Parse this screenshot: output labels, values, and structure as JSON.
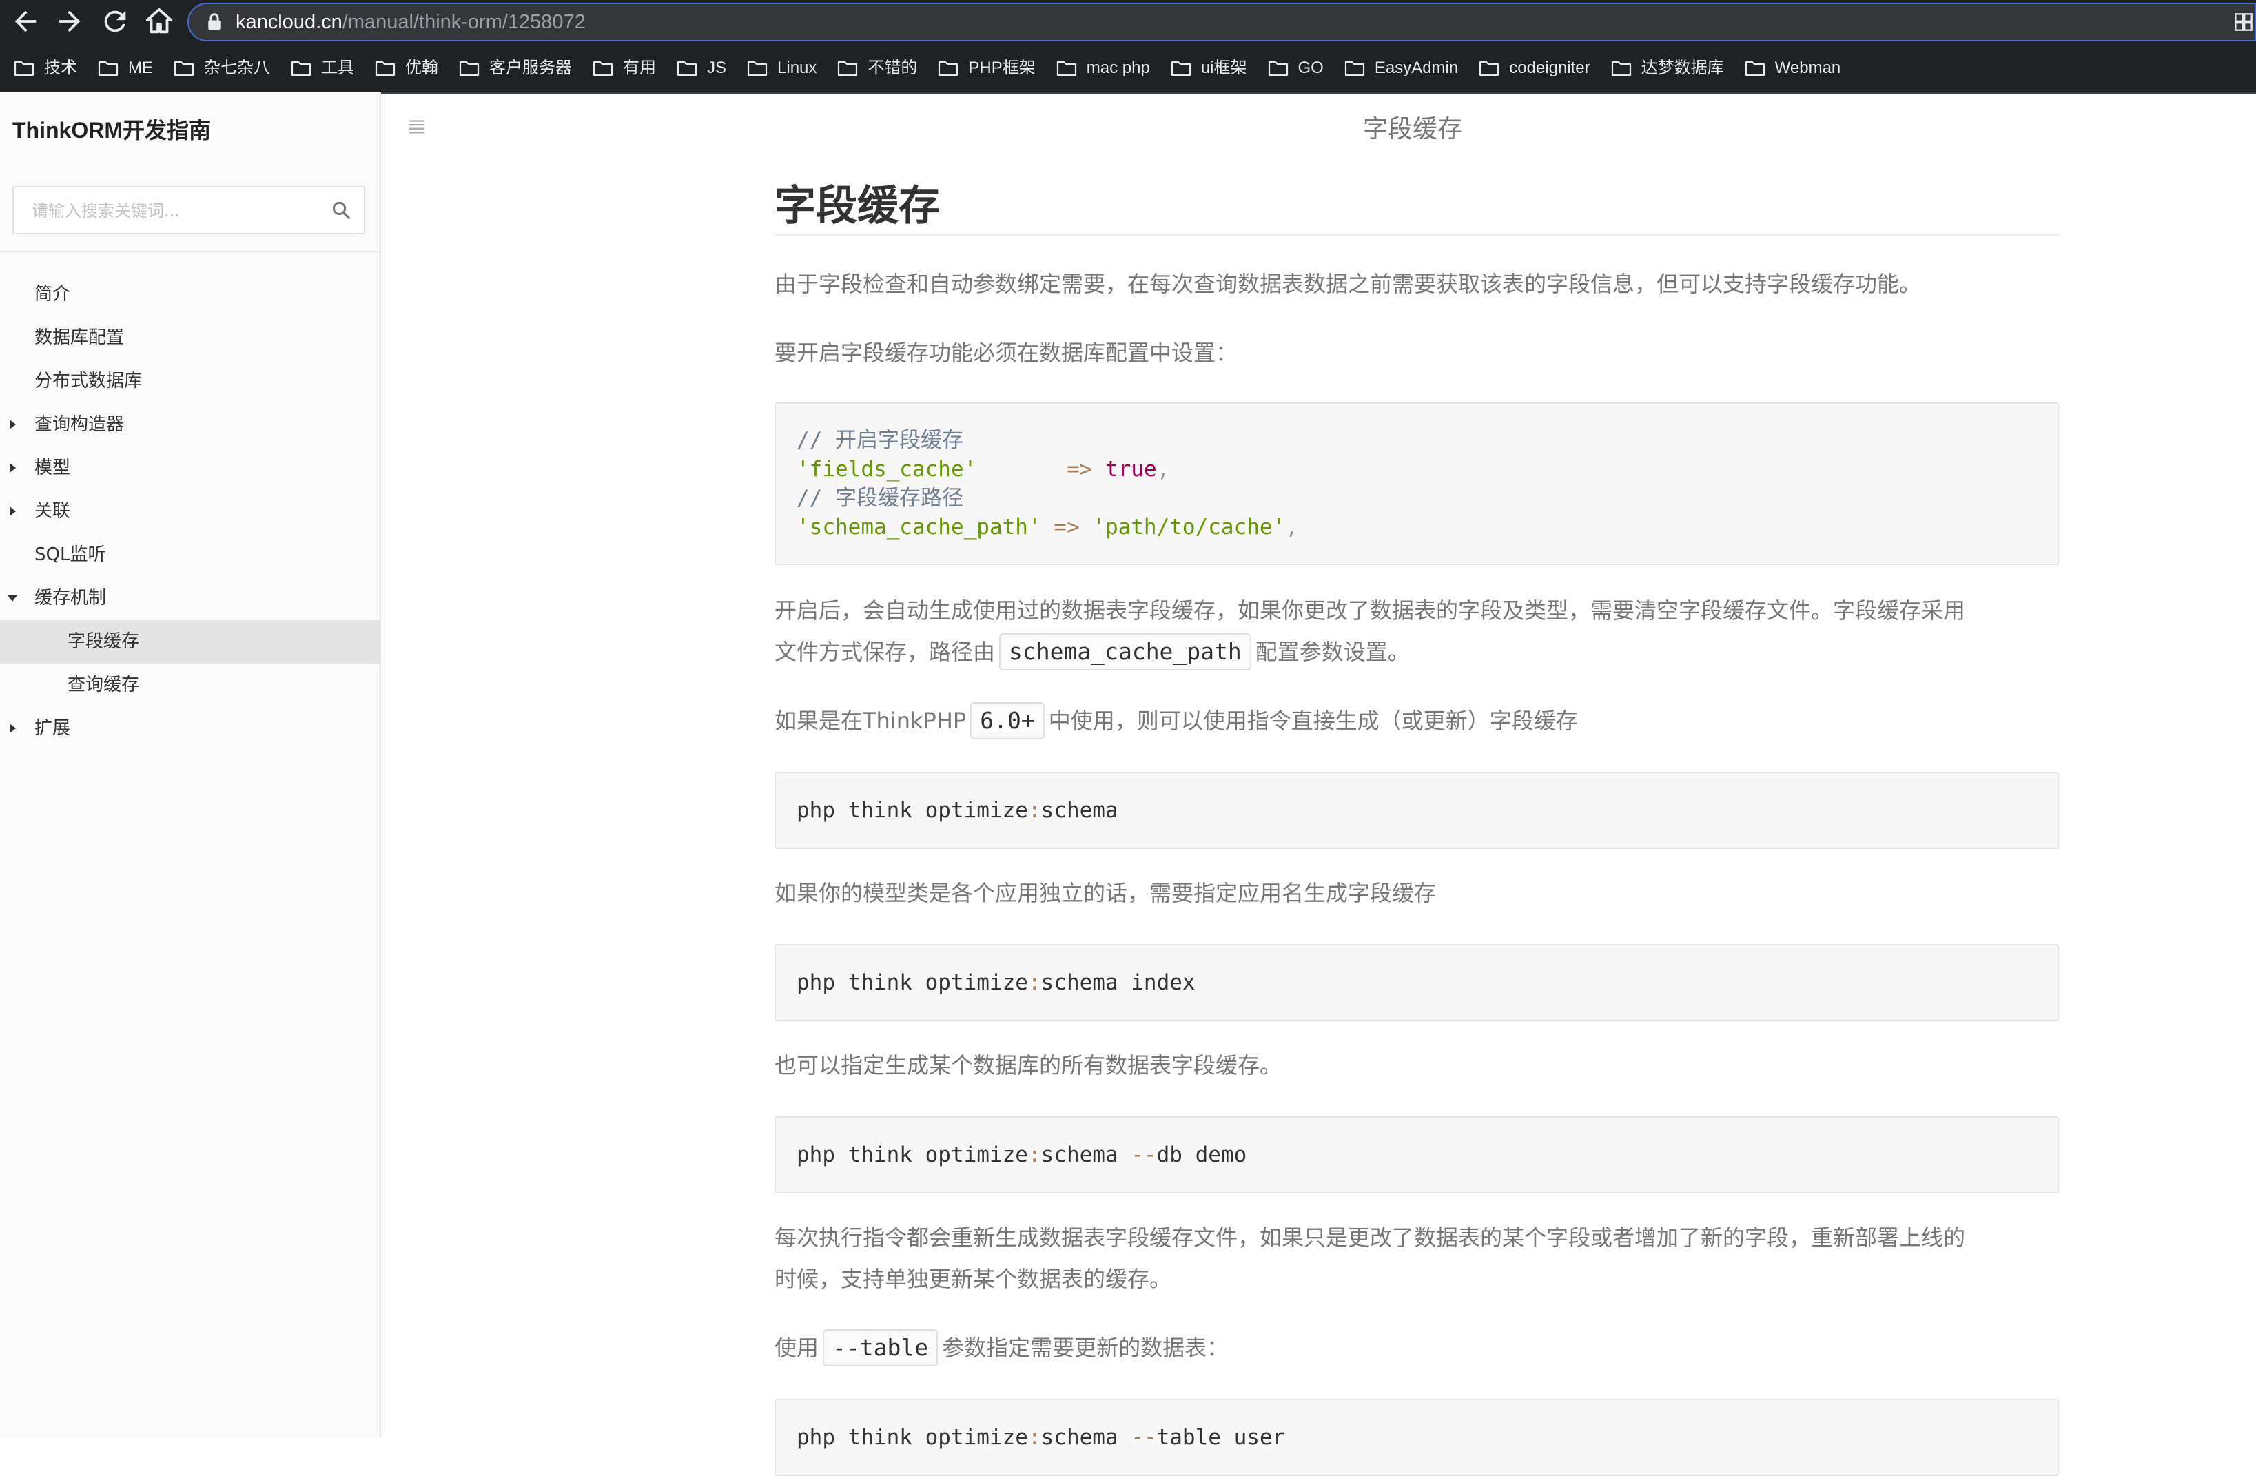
{
  "browser": {
    "url_host": "kancloud.cn",
    "url_path": "/manual/think-orm/1258072",
    "bookmarks": [
      "技术",
      "ME",
      "杂七杂八",
      "工具",
      "优翰",
      "客户服务器",
      "有用",
      "JS",
      "Linux",
      "不错的",
      "PHP框架",
      "mac php",
      "ui框架",
      "GO",
      "EasyAdmin",
      "codeigniter",
      "达梦数据库",
      "Webman"
    ]
  },
  "sidebar": {
    "book_title": "ThinkORM开发指南",
    "search_placeholder": "请输入搜索关键词...",
    "items": [
      {
        "label": "简介",
        "arrow": "none"
      },
      {
        "label": "数据库配置",
        "arrow": "none"
      },
      {
        "label": "分布式数据库",
        "arrow": "none"
      },
      {
        "label": "查询构造器",
        "arrow": "right"
      },
      {
        "label": "模型",
        "arrow": "right"
      },
      {
        "label": "关联",
        "arrow": "right"
      },
      {
        "label": "SQL监听",
        "arrow": "none"
      },
      {
        "label": "缓存机制",
        "arrow": "down"
      },
      {
        "label": "字段缓存",
        "arrow": "none",
        "child": true,
        "active": true
      },
      {
        "label": "查询缓存",
        "arrow": "none",
        "child": true
      },
      {
        "label": "扩展",
        "arrow": "right"
      }
    ]
  },
  "header": {
    "title": "字段缓存"
  },
  "article": {
    "title": "字段缓存",
    "p1": "由于字段检查和自动参数绑定需要，在每次查询数据表数据之前需要获取该表的字段信息，但可以支持字段缓存功能。",
    "p2": "要开启字段缓存功能必须在数据库配置中设置：",
    "code1": {
      "comment1": "// 开启字段缓存",
      "key1": "'fields_cache'",
      "pad1": "      ",
      "arrow": "=>",
      "val1": "true",
      "comma": ",",
      "comment2": "// 字段缓存路径",
      "key2": "'schema_cache_path'",
      "val2": "'path/to/cache'"
    },
    "p3_line1": "开启后，会自动生成使用过的数据表字段缓存，如果你更改了数据表的字段及类型，需要清空字段缓存文件。字段缓存采用",
    "p3_line2_a": "文件方式保存，路径由",
    "p3_code": "schema_cache_path",
    "p3_line2_b": "配置参数设置。",
    "p4_a": "如果是在ThinkPHP",
    "p4_code": "6.0+",
    "p4_b": "中使用，则可以使用指令直接生成（或更新）字段缓存",
    "code2": {
      "a": "php think optimize",
      "colon": ":",
      "b": "schema"
    },
    "p5": "如果你的模型类是各个应用独立的话，需要指定应用名生成字段缓存",
    "code3": {
      "a": "php think optimize",
      "colon": ":",
      "b": "schema index"
    },
    "p6": "也可以指定生成某个数据库的所有数据表字段缓存。",
    "code4": {
      "a": "php think optimize",
      "colon": ":",
      "b": "schema ",
      "dash": "--",
      "c": "db demo"
    },
    "p7_line1": "每次执行指令都会重新生成数据表字段缓存文件，如果只是更改了数据表的某个字段或者增加了新的字段，重新部署上线的",
    "p7_line2": "时候，支持单独更新某个数据表的缓存。",
    "p8_a": "使用",
    "p8_code": "--table",
    "p8_b": "参数指定需要更新的数据表：",
    "code5": {
      "a": "php think optimize",
      "colon": ":",
      "b": "schema ",
      "dash": "--",
      "c": "table user"
    }
  }
}
